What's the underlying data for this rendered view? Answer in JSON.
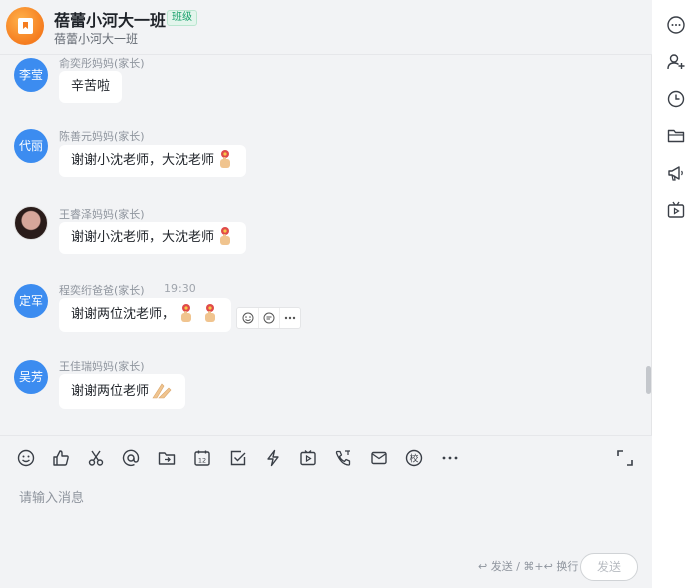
{
  "header": {
    "title": "蓓蕾小河大一班",
    "badge": "班级",
    "subtitle": "蓓蕾小河大一班"
  },
  "messages": [
    {
      "avatar_text": "李莹",
      "sender": "俞奕彤妈妈(家长)",
      "text": "辛苦啦"
    },
    {
      "avatar_text": "代丽",
      "sender": "陈善元妈妈(家长)",
      "text": "谢谢小沈老师，大沈老师",
      "emojis": [
        "flower-hand-emoji"
      ]
    },
    {
      "avatar_text": "",
      "sender": "王睿泽妈妈(家长)",
      "text": "谢谢小沈老师，大沈老师",
      "emojis": [
        "flower-hand-emoji"
      ]
    },
    {
      "avatar_text": "定军",
      "sender": "程奕绗爸爸(家长)",
      "time": "19:30",
      "text": "谢谢两位沈老师，",
      "emojis": [
        "flower-hand-emoji",
        "flower-hand-emoji"
      ]
    },
    {
      "avatar_text": "吴芳",
      "sender": "王佳瑞妈妈(家长)",
      "text": "谢谢两位老师",
      "emojis": [
        "praying-hands-emoji"
      ]
    }
  ],
  "composer": {
    "placeholder": "请输入消息",
    "hint": "↩ 发送 / ⌘+↩ 换行",
    "send_label": "发送",
    "tools": [
      "emoji-icon",
      "thumbs-up-icon",
      "scissors-icon",
      "at-icon",
      "folder-icon",
      "calendar-icon",
      "checkbox-icon",
      "lightning-icon",
      "video-icon",
      "phone-icon",
      "mail-icon",
      "school-icon",
      "more-icon"
    ]
  },
  "right_bar": {
    "icons": [
      "more-icon",
      "add-member-icon",
      "clock-icon",
      "folder-icon",
      "announcement-icon",
      "live-icon"
    ]
  },
  "colors": {
    "accent": "#3c8cf0",
    "badge_green": "#16a06a",
    "background": "#f2f3f5"
  }
}
